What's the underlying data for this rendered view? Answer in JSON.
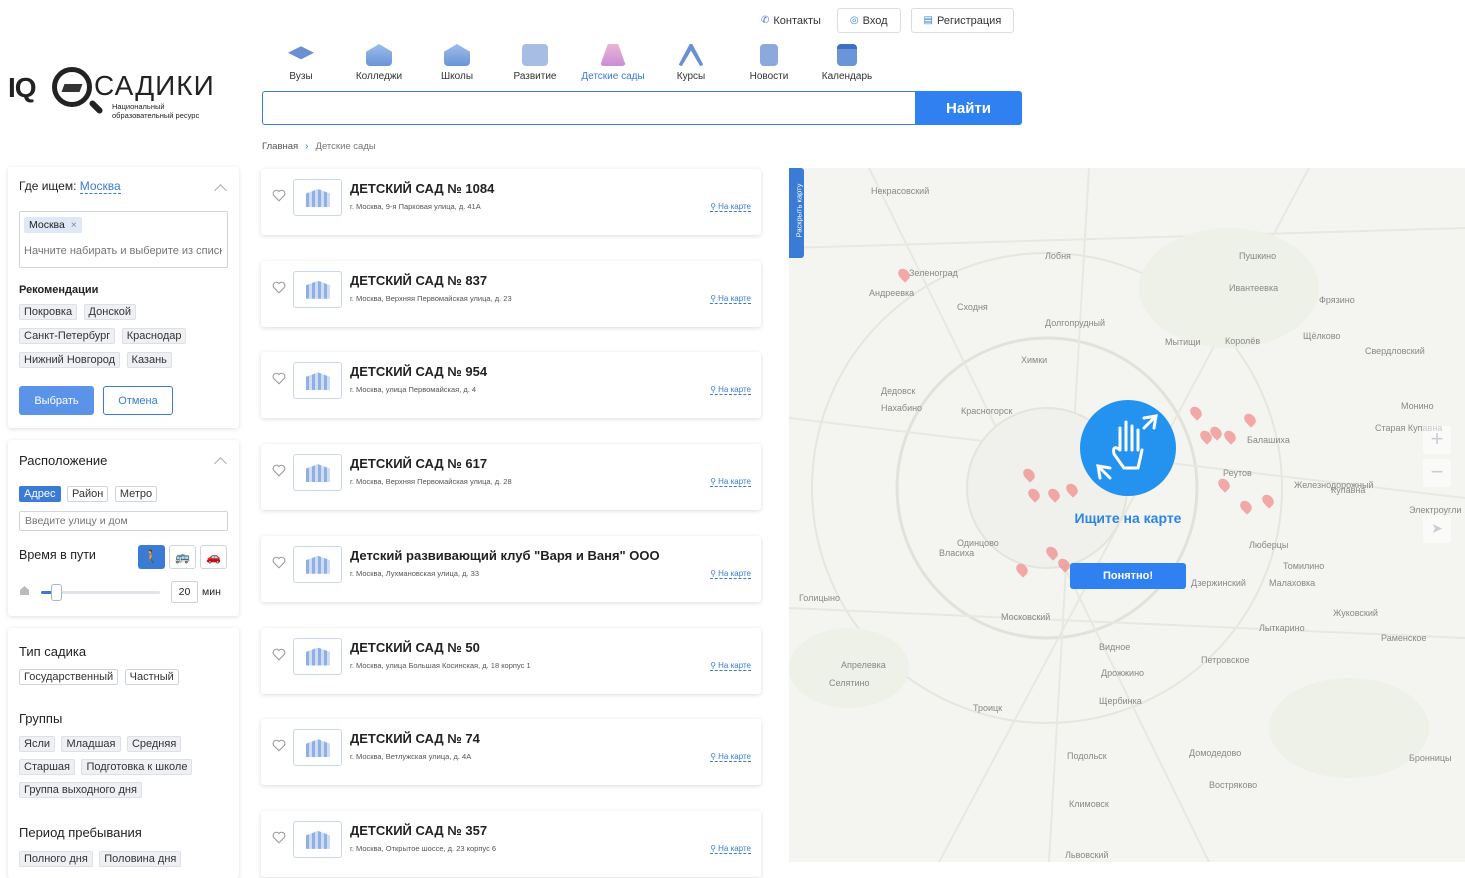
{
  "topnav": {
    "contacts": "Контакты",
    "login": "Вход",
    "register": "Регистрация"
  },
  "logo": {
    "iq": "IQ",
    "name": "САДИКИ",
    "subtitle": "Национальный образовательный ресурс"
  },
  "categories": [
    {
      "label": "Вузы",
      "icon": "graduation-cap-icon"
    },
    {
      "label": "Колледжи",
      "icon": "college-building-icon"
    },
    {
      "label": "Школы",
      "icon": "school-building-icon"
    },
    {
      "label": "Развитие",
      "icon": "puzzle-icon"
    },
    {
      "label": "Детские сады",
      "icon": "slide-icon",
      "active": true
    },
    {
      "label": "Курсы",
      "icon": "compass-tools-icon"
    },
    {
      "label": "Новости",
      "icon": "newspaper-icon"
    },
    {
      "label": "Календарь",
      "icon": "calendar-icon"
    }
  ],
  "search": {
    "value": "",
    "button": "Найти"
  },
  "breadcrumb": {
    "home": "Главная",
    "current": "Детские сады"
  },
  "where": {
    "label": "Где ищем:",
    "city": "Москва",
    "tag": "Москва",
    "placeholder": "Начните набирать и выберите из списка",
    "rec_title": "Рекомендации",
    "recommendations": [
      "Покровка",
      "Донской",
      "Санкт-Петербург",
      "Краснодар",
      "Нижний Новгород",
      "Казань"
    ],
    "ok": "Выбрать",
    "cancel": "Отмена"
  },
  "location": {
    "title": "Расположение",
    "modes": [
      "Адрес",
      "Район",
      "Метро"
    ],
    "placeholder": "Введите улицу и дом",
    "travel_label": "Время в пути",
    "minutes": "20",
    "minutes_unit": "мин",
    "travel_fraction": 0.13
  },
  "type": {
    "title": "Тип садика",
    "options": [
      "Государственный",
      "Частный"
    ]
  },
  "groups": {
    "title": "Группы",
    "options": [
      "Ясли",
      "Младшая",
      "Средняя",
      "Старшая",
      "Подготовка к школе",
      "Группа выходного дня"
    ]
  },
  "stay": {
    "title": "Период пребывания",
    "options": [
      "Полного дня",
      "Половина дня"
    ]
  },
  "on_map": "На карте",
  "kindergartens": [
    {
      "name": "ДЕТСКИЙ САД № 1084",
      "address": "г. Москва, 9-я Парковая улица, д. 41А"
    },
    {
      "name": "ДЕТСКИЙ САД № 837",
      "address": "г. Москва, Верхняя Первомайская улица, д. 23"
    },
    {
      "name": "ДЕТСКИЙ САД № 954",
      "address": "г. Москва, улица Первомайская, д. 4"
    },
    {
      "name": "ДЕТСКИЙ САД № 617",
      "address": "г. Москва, Верхняя Первомайская улица, д. 28"
    },
    {
      "name": "Детский развивающий клуб \"Варя и Ваня\" ООО",
      "address": "г. Москва, Лухмановская улица, д. 33"
    },
    {
      "name": "ДЕТСКИЙ САД № 50",
      "address": "г. Москва, улица Большая Косинская, д. 18 корпус 1"
    },
    {
      "name": "ДЕТСКИЙ САД № 74",
      "address": "г. Москва, Ветлужская улица, д. 4А"
    },
    {
      "name": "ДЕТСКИЙ САД № 357",
      "address": "г. Москва, Открытое шоссе, д. 23 корпус 6"
    }
  ],
  "map": {
    "expand": "Раскрыть карту",
    "hint_title": "Ищите на карте",
    "hint_button": "Понятно!",
    "zoom_in": "+",
    "zoom_out": "−",
    "places": [
      "Некрасовский",
      "Лобня",
      "Пушкино",
      "Зеленоград",
      "Андреевка",
      "Сходня",
      "Долгопрудный",
      "Ивантеевка",
      "Фрязино",
      "Химки",
      "Мытищи",
      "Королёв",
      "Щёлково",
      "Свердловский",
      "Красногорск",
      "Балашиха",
      "Реутов",
      "Железнодорожный",
      "Одинцово",
      "Люберцы",
      "Власиха",
      "Московский",
      "Видное",
      "Дзержинский",
      "Жуковский",
      "Апрелевка",
      "Троицк",
      "Подольск",
      "Домодедово",
      "Климовск",
      "Щербинка",
      "Раменское",
      "Лыткарино",
      "Томилино",
      "Малаховка",
      "Купавна",
      "Старая Купавна",
      "Монино",
      "Голицыно",
      "Селятино",
      "Дрожжино",
      "Петровское",
      "Бронницы",
      "Востряково",
      "Львовский",
      "Электроугли",
      "Нахабино",
      "Дедовск"
    ]
  }
}
